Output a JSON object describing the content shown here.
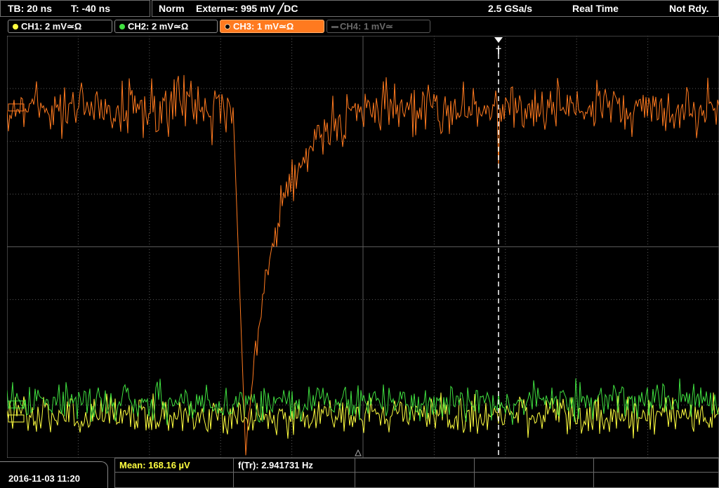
{
  "top_bar": {
    "timebase": "TB: 20 ns",
    "trigger_time": "T: -40 ns",
    "mode": "Norm",
    "trigger_source": "Extern≃: 995 mV ╱DC",
    "sample_rate": "2.5 GSa/s",
    "acquisition": "Real Time",
    "status": "Not Rdy."
  },
  "channels": [
    {
      "label": "CH1: 2 mV≃Ω",
      "color": "#ffff40",
      "active": true
    },
    {
      "label": "CH2: 2 mV≃Ω",
      "color": "#40e040",
      "active": true
    },
    {
      "label": "CH3: 1 mV≃Ω",
      "color": "#ff7a1f",
      "active": true,
      "selected": true
    },
    {
      "label": "CH4: 1 mV≃",
      "color": "#6a6a6a",
      "active": false
    }
  ],
  "trigger_marker": "T",
  "footer": {
    "datetime": "2016-11-03 11:20",
    "mean": "Mean: 168.16 µV",
    "frequency": "f(Tr): 2.941731 Hz"
  },
  "colors": {
    "grid": "#5a5a5a",
    "ch3_trace": "#ff7a1f",
    "ch2_trace": "#40e040",
    "ch1_trace": "#ffff40"
  }
}
